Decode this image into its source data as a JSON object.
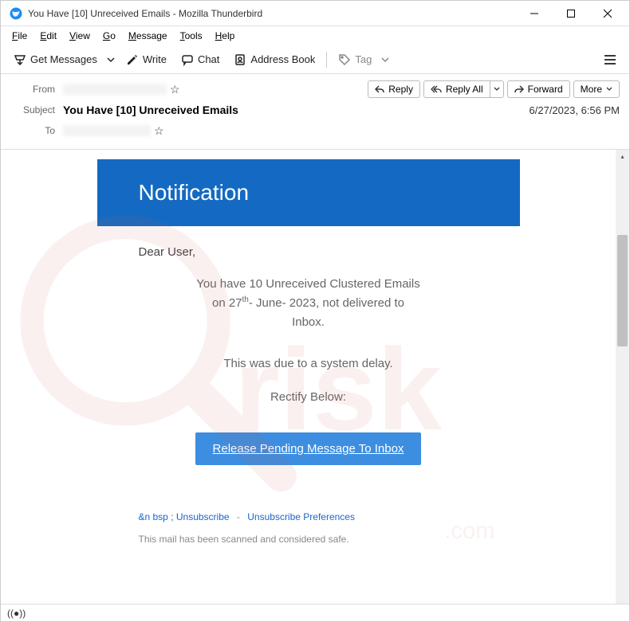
{
  "window": {
    "title": "You Have [10] Unreceived Emails - Mozilla Thunderbird"
  },
  "menu": {
    "file": "File",
    "edit": "Edit",
    "view": "View",
    "go": "Go",
    "message": "Message",
    "tools": "Tools",
    "help": "Help"
  },
  "toolbar": {
    "get_messages": "Get Messages",
    "write": "Write",
    "chat": "Chat",
    "address_book": "Address Book",
    "tag": "Tag"
  },
  "header": {
    "from_label": "From",
    "subject_label": "Subject",
    "to_label": "To",
    "subject": "You Have [10] Unreceived Emails",
    "date": "6/27/2023, 6:56 PM",
    "actions": {
      "reply": "Reply",
      "reply_all": "Reply All",
      "forward": "Forward",
      "more": "More"
    }
  },
  "email": {
    "banner": "Notification",
    "greeting": "Dear User,",
    "line1_a": "You have 10 Unreceived Clustered Emails",
    "line1_b": "on 27",
    "line1_sup": "th",
    "line1_c": "- June- 2023, not delivered to",
    "line1_d": "Inbox.",
    "line2": "This was due to a system delay.",
    "line3": "Rectify Below:",
    "cta": "Release Pending Message To Inbox",
    "unsub_prefix": "&n bsp ; Unsubscribe",
    "unsub_prefs": "Unsubscribe Preferences",
    "safe": "This mail has been scanned and considered safe."
  }
}
